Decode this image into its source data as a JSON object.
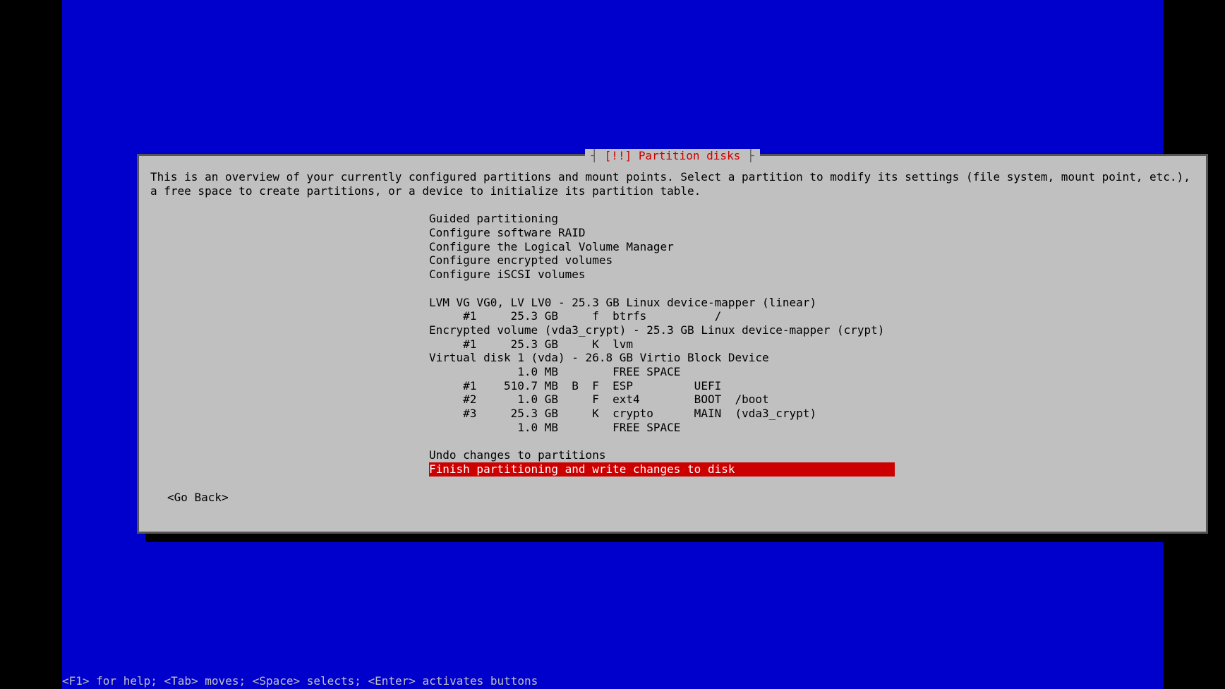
{
  "dialog": {
    "title": "[!!] Partition disks",
    "description": "This is an overview of your currently configured partitions and mount points. Select a partition to modify its settings (file system, mount point, etc.), a free space to create partitions, or a device to initialize its partition table.",
    "menu": {
      "guided": "Guided partitioning",
      "raid": "Configure software RAID",
      "lvm": "Configure the Logical Volume Manager",
      "encrypted": "Configure encrypted volumes",
      "iscsi": "Configure iSCSI volumes"
    },
    "devices": {
      "lvm_vg": "LVM VG VG0, LV LV0 - 25.3 GB Linux device-mapper (linear)",
      "lvm_part1": "     #1     25.3 GB     f  btrfs          /",
      "crypt_vol": "Encrypted volume (vda3_crypt) - 25.3 GB Linux device-mapper (crypt)",
      "crypt_part1": "     #1     25.3 GB     K  lvm",
      "vda": "Virtual disk 1 (vda) - 26.8 GB Virtio Block Device",
      "vda_free1": "             1.0 MB        FREE SPACE",
      "vda_part1": "     #1    510.7 MB  B  F  ESP         UEFI",
      "vda_part2": "     #2      1.0 GB     F  ext4        BOOT  /boot",
      "vda_part3": "     #3     25.3 GB     K  crypto      MAIN  (vda3_crypt)",
      "vda_free2": "             1.0 MB        FREE SPACE"
    },
    "actions": {
      "undo": "Undo changes to partitions",
      "finish": "Finish partitioning and write changes to disk"
    },
    "go_back": "<Go Back>"
  },
  "status_bar": "<F1> for help; <Tab> moves; <Space> selects; <Enter> activates buttons"
}
